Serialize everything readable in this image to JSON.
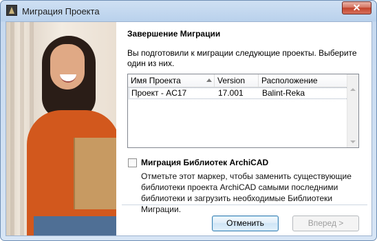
{
  "window": {
    "title": "Миграция Проекта",
    "close_symbol": "✕"
  },
  "main": {
    "heading": "Завершение Миграции",
    "description": "Вы подготовили к миграции следующие проекты. Выберите один из них."
  },
  "project_list": {
    "columns": [
      "Имя Проекта",
      "Version",
      "Расположение"
    ],
    "sorted_column": "Имя Проекта",
    "rows": [
      {
        "name": "Проект - AC17",
        "version": "17.001",
        "location": "Balint-Reka"
      }
    ]
  },
  "library_migration": {
    "checked": false,
    "label": "Миграция Библиотек ArchiCAD",
    "description": "Отметьте этот маркер, чтобы заменить существующие библиотеки проекта ArchiCAD самыми последними библиотеки и загрузить необходимые Библиотеки Миграции."
  },
  "buttons": {
    "cancel": "Отменить",
    "next": "Вперед >"
  }
}
